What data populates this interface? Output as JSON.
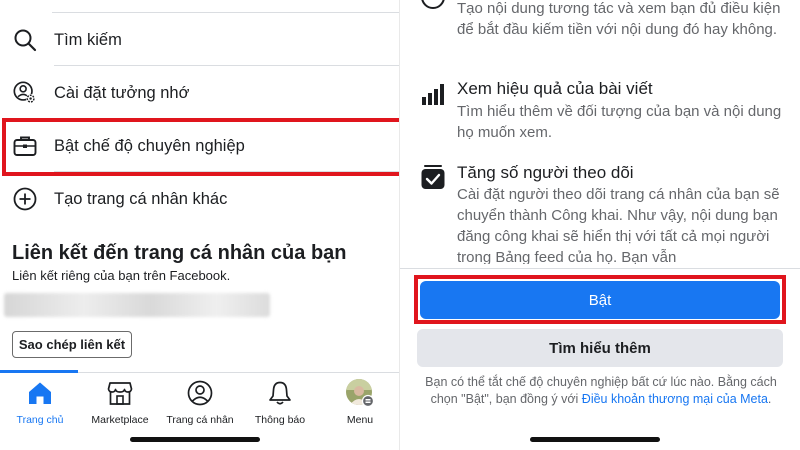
{
  "left": {
    "menu": [
      {
        "label": "Tìm kiếm",
        "icon": "search-icon"
      },
      {
        "label": "Cài đặt tưởng nhớ",
        "icon": "memorial-settings-icon"
      },
      {
        "label": "Bật chế độ chuyên nghiệp",
        "icon": "briefcase-icon"
      },
      {
        "label": "Tạo trang cá nhân khác",
        "icon": "plus-circle-icon"
      }
    ],
    "link_section": {
      "title": "Liên kết đến trang cá nhân của bạn",
      "subtitle": "Liên kết riêng của bạn trên Facebook.",
      "copy_button": "Sao chép liên kết"
    },
    "nav": [
      {
        "label": "Trang chủ",
        "icon": "home-icon",
        "active": true
      },
      {
        "label": "Marketplace",
        "icon": "marketplace-icon",
        "active": false
      },
      {
        "label": "Trang cá nhân",
        "icon": "profile-icon",
        "active": false
      },
      {
        "label": "Thông báo",
        "icon": "bell-icon",
        "active": false
      },
      {
        "label": "Menu",
        "icon": "avatar-menu-icon",
        "active": false
      }
    ]
  },
  "right": {
    "intro_text": "Tạo nội dung tương tác và xem bạn đủ điều kiện để bắt đầu kiếm tiền với nội dung đó hay không.",
    "features": [
      {
        "title": "Xem hiệu quả của bài viết",
        "icon": "bar-chart-icon",
        "desc": "Tìm hiểu thêm về đối tượng của bạn và nội dung họ muốn xem."
      },
      {
        "title": "Tăng số người theo dõi",
        "icon": "checkbox-icon",
        "desc": "Cài đặt người theo dõi trang cá nhân của bạn sẽ chuyển thành Công khai. Như vậy, nội dung bạn đăng công khai sẽ hiển thị với tất cả mọi người trong Bảng feed của họ. Bạn vẫn"
      }
    ],
    "primary_button": "Bật",
    "secondary_button": "Tìm hiểu thêm",
    "footnote_text": "Bạn có thể tắt chế độ chuyên nghiệp bất cứ lúc nào. Bằng cách chọn \"Bật\", bạn đồng ý với ",
    "footnote_link": "Điều khoản thương mại của Meta",
    "footnote_end": "."
  },
  "colors": {
    "accent": "#1877f2",
    "highlight": "#e0151d",
    "secondary_bg": "#e4e6eb"
  }
}
